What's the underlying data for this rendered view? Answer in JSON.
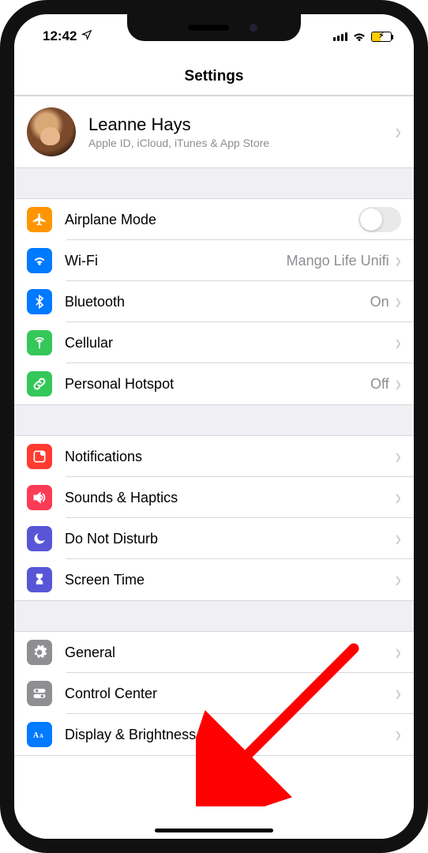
{
  "status": {
    "time": "12:42",
    "location_icon": "location"
  },
  "title": "Settings",
  "profile": {
    "name": "Leanne Hays",
    "subtitle": "Apple ID, iCloud, iTunes & App Store"
  },
  "groups": [
    {
      "rows": [
        {
          "id": "airplane",
          "icon": "airplane",
          "color": "orange",
          "label": "Airplane Mode",
          "type": "toggle",
          "on": false
        },
        {
          "id": "wifi",
          "icon": "wifi",
          "color": "blue",
          "label": "Wi-Fi",
          "value": "Mango Life Unifi",
          "type": "disclosure"
        },
        {
          "id": "bluetooth",
          "icon": "bluetooth",
          "color": "blue",
          "label": "Bluetooth",
          "value": "On",
          "type": "disclosure"
        },
        {
          "id": "cellular",
          "icon": "antenna",
          "color": "green",
          "label": "Cellular",
          "type": "disclosure"
        },
        {
          "id": "hotspot",
          "icon": "link",
          "color": "green",
          "label": "Personal Hotspot",
          "value": "Off",
          "type": "disclosure"
        }
      ]
    },
    {
      "rows": [
        {
          "id": "notifications",
          "icon": "bell-square",
          "color": "red",
          "label": "Notifications",
          "type": "disclosure"
        },
        {
          "id": "sounds",
          "icon": "speaker",
          "color": "rose",
          "label": "Sounds & Haptics",
          "type": "disclosure"
        },
        {
          "id": "dnd",
          "icon": "moon",
          "color": "indigo",
          "label": "Do Not Disturb",
          "type": "disclosure"
        },
        {
          "id": "screentime",
          "icon": "hourglass",
          "color": "indigo",
          "label": "Screen Time",
          "type": "disclosure"
        }
      ]
    },
    {
      "rows": [
        {
          "id": "general",
          "icon": "gear",
          "color": "gray",
          "label": "General",
          "type": "disclosure"
        },
        {
          "id": "controlcenter",
          "icon": "switches",
          "color": "gray",
          "label": "Control Center",
          "type": "disclosure"
        },
        {
          "id": "display",
          "icon": "display-aa",
          "color": "blue",
          "label": "Display & Brightness",
          "type": "disclosure"
        }
      ]
    }
  ],
  "annotation": {
    "target": "general",
    "color": "#ff0000"
  }
}
